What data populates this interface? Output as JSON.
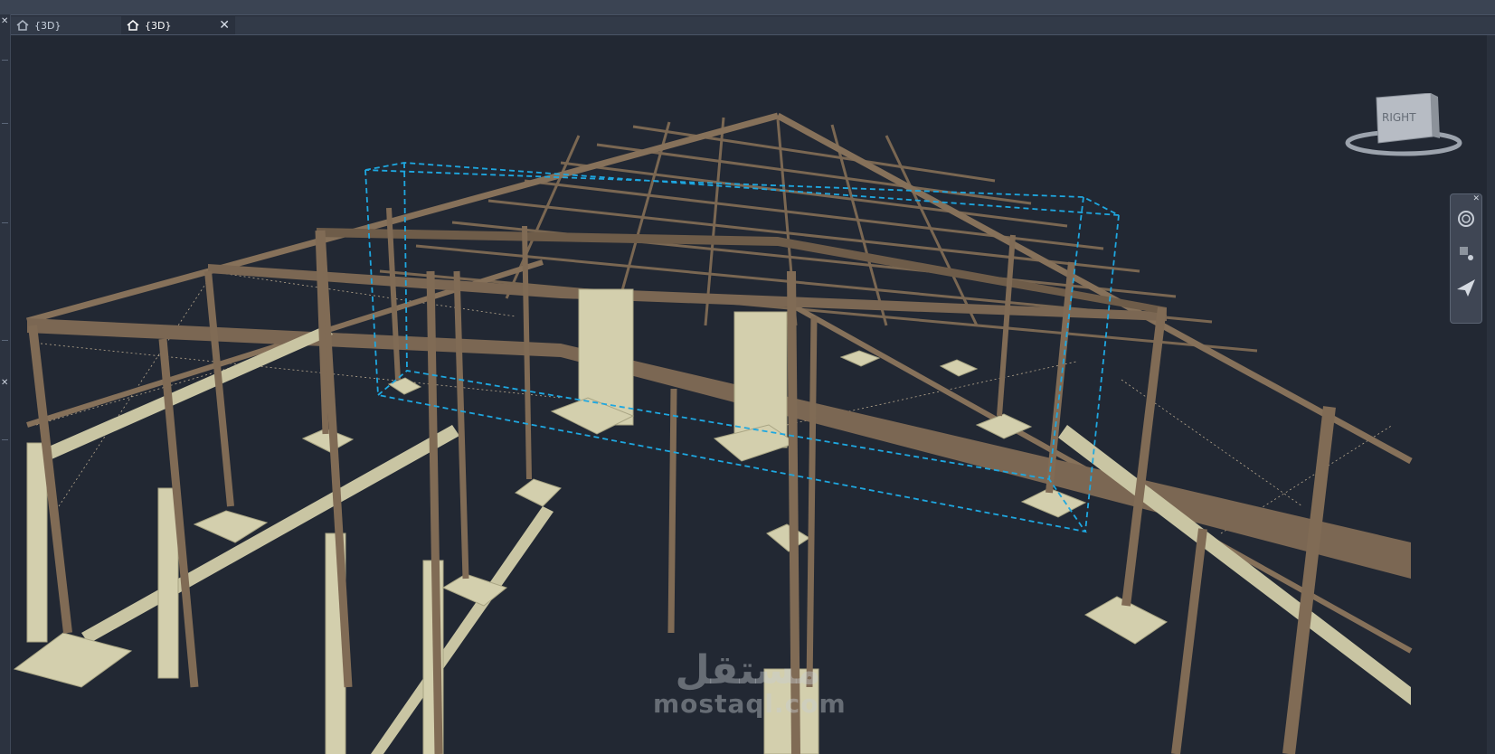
{
  "tabs": [
    {
      "label": "{3D}",
      "active": false
    },
    {
      "label": "{3D}",
      "active": true
    }
  ],
  "viewcube": {
    "face_label": "RIGHT"
  },
  "watermark": {
    "arabic": "مستقل",
    "latin": "mostaql.com"
  },
  "colors": {
    "background": "#222833",
    "steel": "#7e6a55",
    "concrete": "#d3cfad",
    "selection": "#1ea7e0"
  },
  "icons": [
    "home-icon",
    "close-icon",
    "viewcube-icon",
    "steering-wheel-icon",
    "orbit-icon",
    "paper-plane-icon"
  ]
}
